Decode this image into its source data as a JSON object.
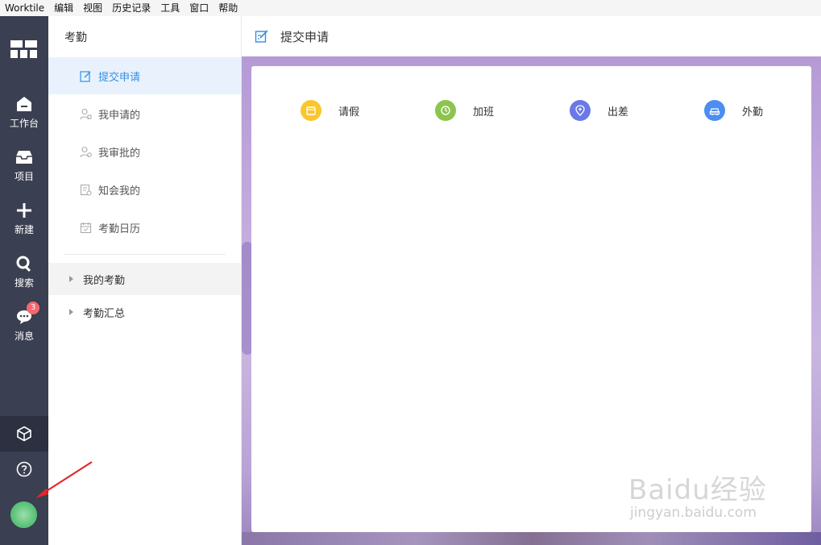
{
  "menubar": {
    "items": [
      "Worktile",
      "编辑",
      "视图",
      "历史记录",
      "工具",
      "窗口",
      "帮助"
    ]
  },
  "rail": {
    "items": [
      {
        "label": "工作台",
        "icon": "home-icon"
      },
      {
        "label": "项目",
        "icon": "inbox-icon"
      },
      {
        "label": "新建",
        "icon": "plus-icon"
      },
      {
        "label": "搜索",
        "icon": "search-icon"
      },
      {
        "label": "消息",
        "icon": "chat-icon",
        "badge": "3"
      }
    ]
  },
  "sidebar": {
    "title": "考勤",
    "items": [
      {
        "label": "提交申请",
        "icon": "edit-icon",
        "active": true
      },
      {
        "label": "我申请的",
        "icon": "user-icon"
      },
      {
        "label": "我审批的",
        "icon": "user-check-icon"
      },
      {
        "label": "知会我的",
        "icon": "document-icon"
      },
      {
        "label": "考勤日历",
        "icon": "calendar-icon"
      }
    ],
    "groups": [
      {
        "label": "我的考勤"
      },
      {
        "label": "考勤汇总"
      }
    ]
  },
  "main": {
    "title": "提交申请",
    "options": [
      {
        "label": "请假",
        "color": "#f8c72e",
        "icon": "calendar-icon"
      },
      {
        "label": "加班",
        "color": "#8bc54d",
        "icon": "clock-icon"
      },
      {
        "label": "出差",
        "color": "#6b79e6",
        "icon": "location-icon"
      },
      {
        "label": "外勤",
        "color": "#4c8ef0",
        "icon": "car-icon"
      }
    ]
  },
  "watermark": {
    "brand": "Baidu经验",
    "site": "jingyan.baidu.com"
  },
  "colors": {
    "rail_bg": "#3a3f51",
    "accent": "#348fe4",
    "active_bg": "#e9f2fc",
    "badge": "#f6676c"
  }
}
